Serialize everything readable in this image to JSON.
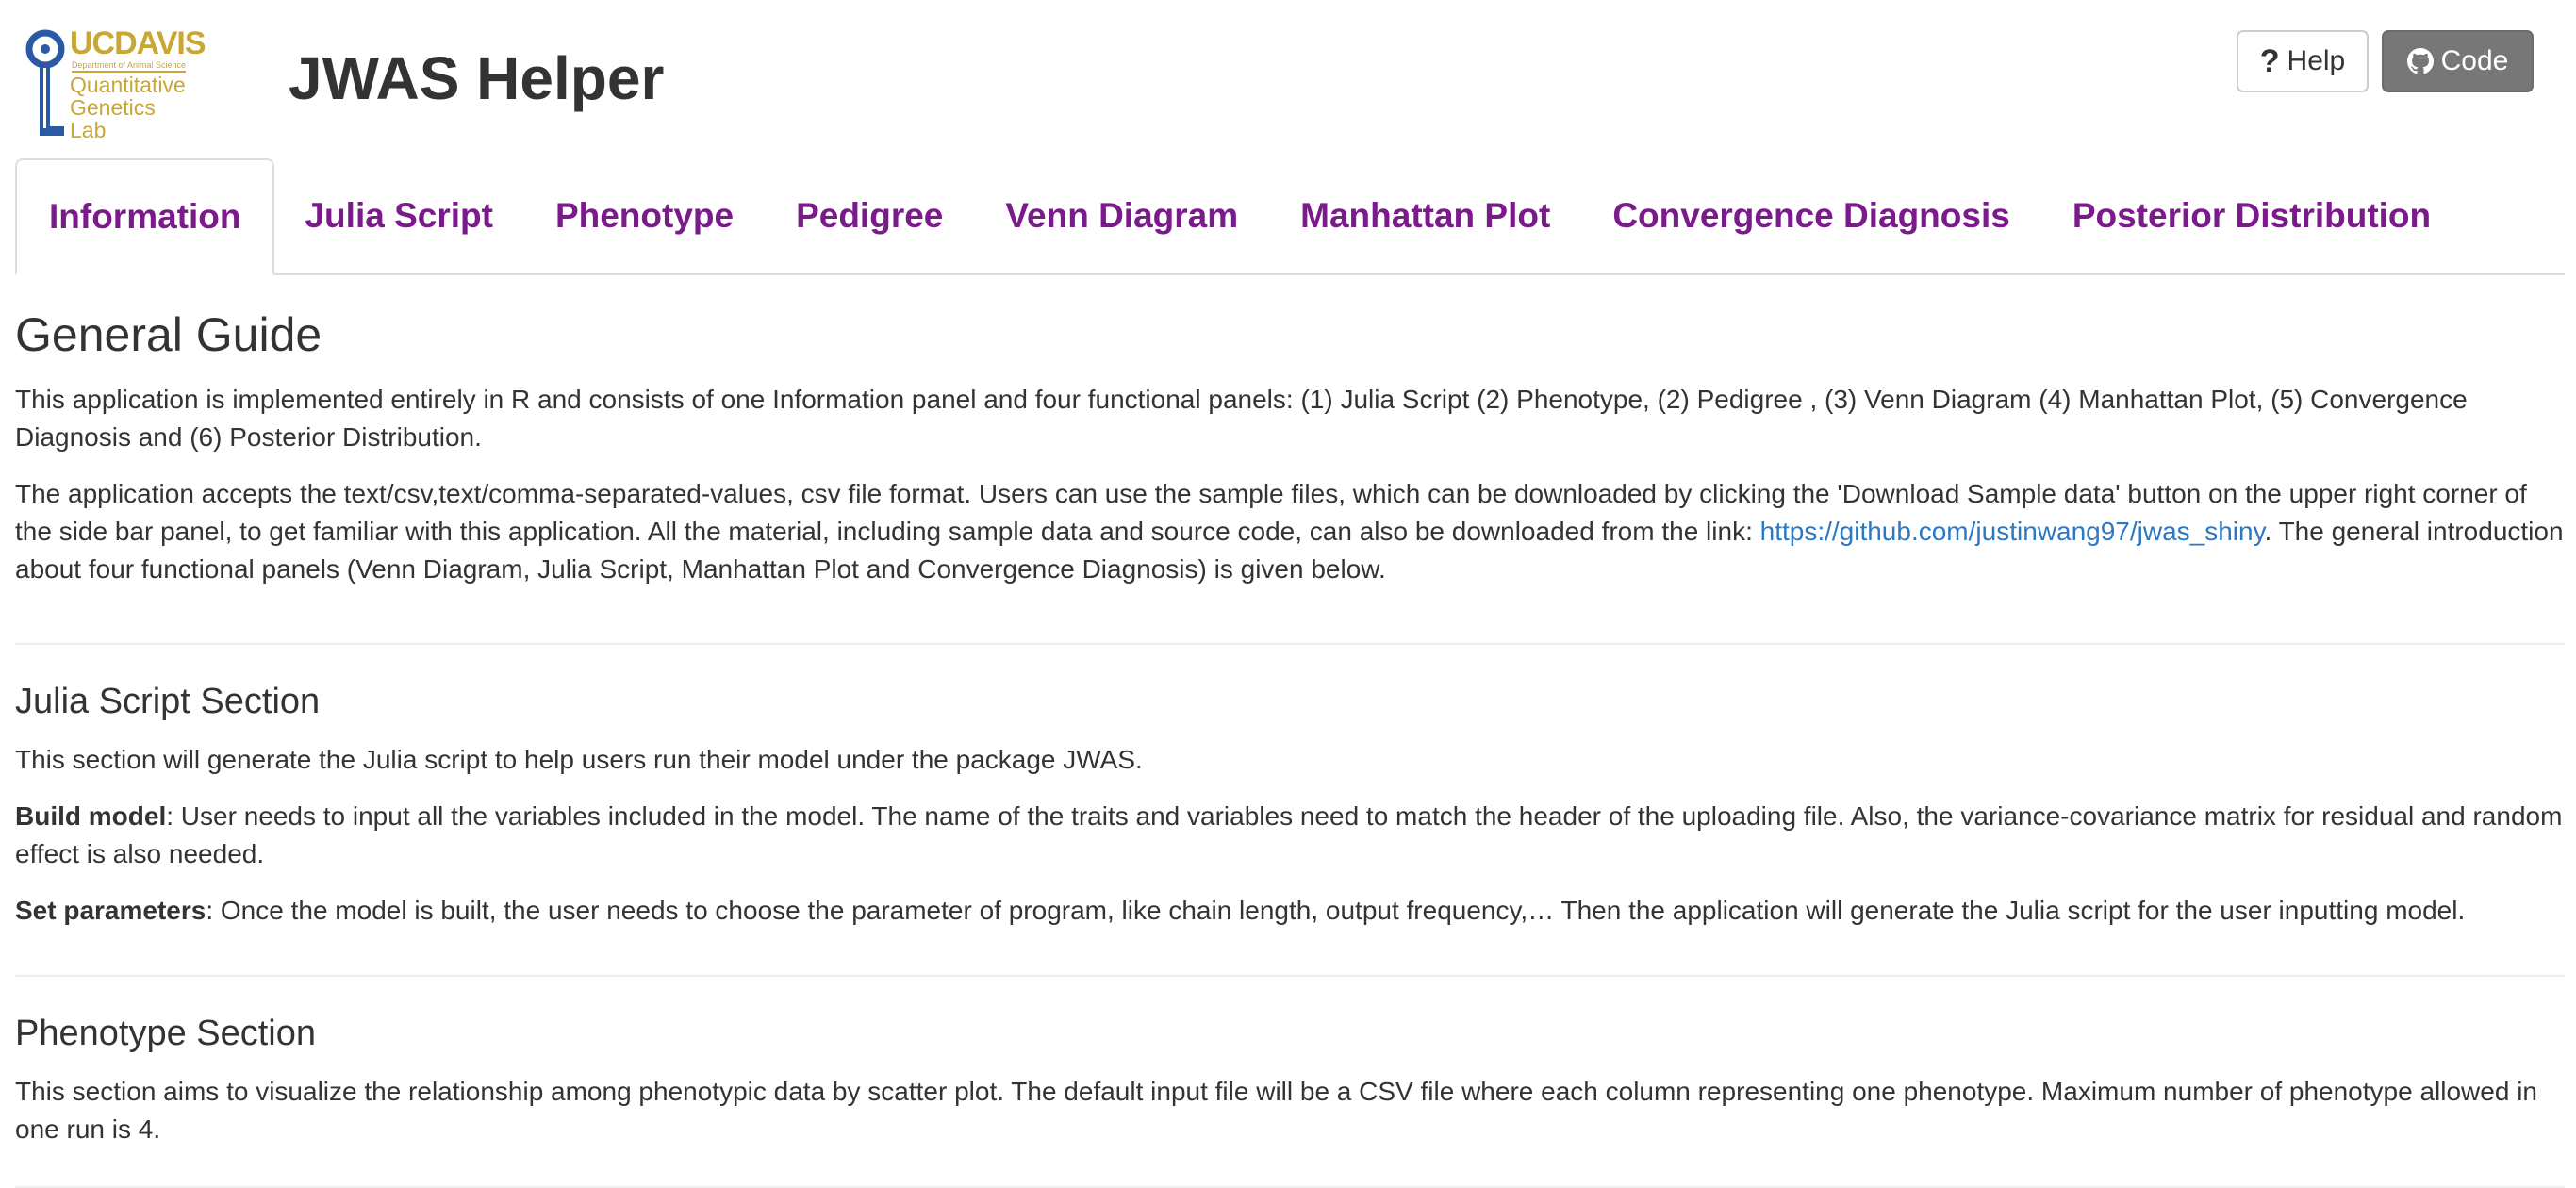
{
  "logo": {
    "uc": "UC",
    "davis": "DAVIS",
    "dept": "Department of Animal Science",
    "lab": "Quantitative\nGenetics\nLab"
  },
  "header": {
    "title": "JWAS Helper",
    "help_label": "Help",
    "code_label": "Code"
  },
  "tabs": [
    {
      "label": "Information",
      "active": true
    },
    {
      "label": "Julia Script"
    },
    {
      "label": "Phenotype"
    },
    {
      "label": "Pedigree"
    },
    {
      "label": "Venn Diagram"
    },
    {
      "label": "Manhattan Plot"
    },
    {
      "label": "Convergence Diagnosis"
    },
    {
      "label": "Posterior Distribution"
    }
  ],
  "content": {
    "guide_title": "General Guide",
    "guide_p1": "This application is implemented entirely in R and consists of one Information panel and four functional panels: (1) Julia Script (2) Phenotype, (2) Pedigree , (3) Venn Diagram (4) Manhattan Plot, (5) Convergence Diagnosis and (6) Posterior Distribution.",
    "guide_p2_before": "The application accepts the text/csv,text/comma-separated-values, csv file format. Users can use the sample files, which can be downloaded by clicking the 'Download Sample data' button on the upper right corner of the side bar panel, to get familiar with this application. All the material, including sample data and source code, can also be downloaded from the link: ",
    "guide_p2_link": "https://github.com/justinwang97/jwas_shiny",
    "guide_p2_after": ". The general introduction about four functional panels (Venn Diagram, Julia Script, Manhattan Plot and Convergence Diagnosis) is given below.",
    "julia_title": "Julia Script Section",
    "julia_p1": "This section will generate the Julia script to help users run their model under the package JWAS.",
    "build_label": "Build model",
    "build_text": ": User needs to input all the variables included in the model. The name of the traits and variables need to match the header of the uploading file. Also, the variance-covariance matrix for residual and random effect is also needed.",
    "set_label": "Set parameters",
    "set_text": ": Once the model is built, the user needs to choose the parameter of program, like chain length, output frequency,… Then the application will generate the Julia script for the user inputting model.",
    "pheno_title": "Phenotype Section",
    "pheno_p1": "This section aims to visualize the relationship among phenotypic data by scatter plot. The default input file will be a CSV file where each column representing one phenotype. Maximum number of phenotype allowed in one run is 4."
  }
}
